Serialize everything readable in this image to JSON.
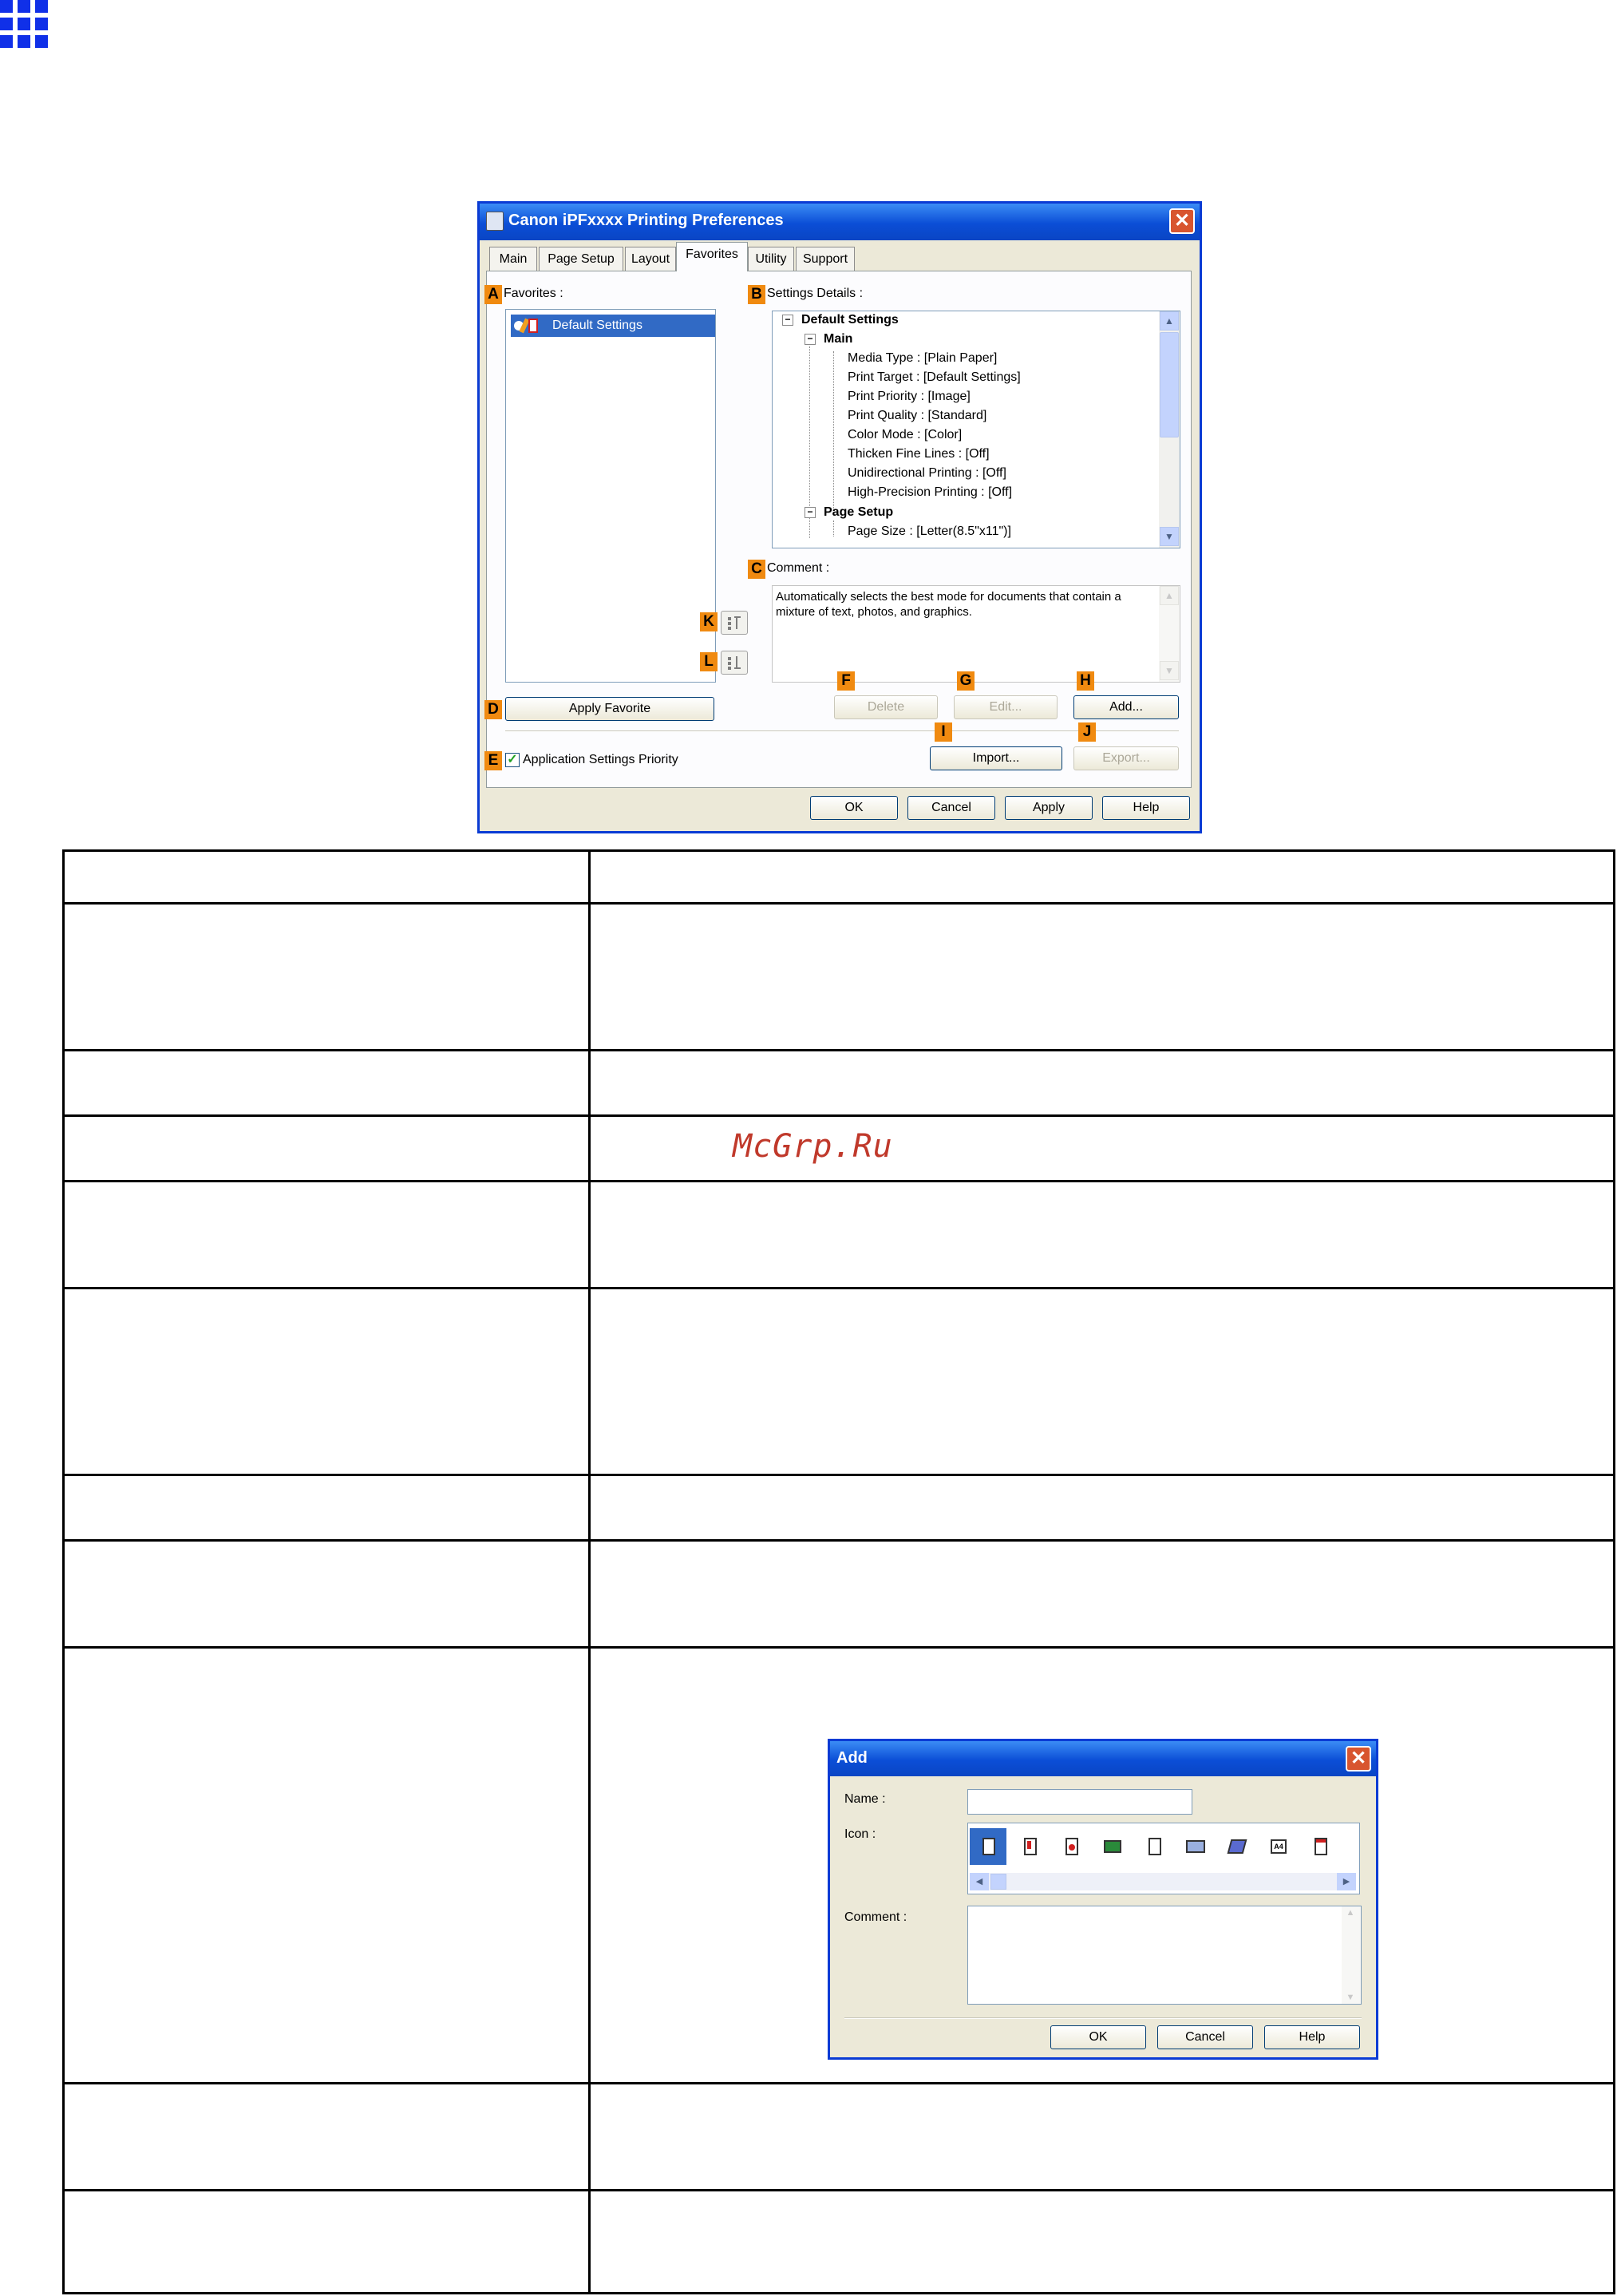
{
  "main_dialog": {
    "title": "Canon iPFxxxx Printing Preferences",
    "close_symbol": "✕",
    "tabs": [
      "Main",
      "Page Setup",
      "Layout",
      "Favorites",
      "Utility",
      "Support"
    ],
    "active_tab": "Favorites",
    "badges": [
      "A",
      "B",
      "C",
      "D",
      "E",
      "F",
      "G",
      "H",
      "I",
      "J",
      "K",
      "L"
    ],
    "favorites": {
      "label": "Favorites :",
      "items": [
        "Default Settings"
      ]
    },
    "settings_details": {
      "label": "Settings Details :",
      "root": "Default Settings",
      "main_group": "Main",
      "main_items": [
        "Media Type : [Plain Paper]",
        "Print Target : [Default Settings]",
        "Print Priority : [Image]",
        "Print Quality : [Standard]",
        "Color Mode : [Color]",
        "Thicken Fine Lines : [Off]",
        "Unidirectional Printing : [Off]",
        "High-Precision Printing : [Off]"
      ],
      "page_setup_group": "Page Setup",
      "page_setup_items": [
        "Page Size : [Letter(8.5\"x11\")]"
      ]
    },
    "comment": {
      "label": "Comment :",
      "text": "Automatically selects the best mode for documents that contain a mixture of text, photos, and graphics."
    },
    "buttons": {
      "apply_favorite": "Apply Favorite",
      "delete": "Delete",
      "edit": "Edit...",
      "add": "Add...",
      "import": "Import...",
      "export": "Export...",
      "ok": "OK",
      "cancel": "Cancel",
      "apply": "Apply",
      "help": "Help"
    },
    "application_settings_priority": {
      "label": "Application Settings Priority",
      "checked": true
    },
    "colors": {
      "title_bar": "#0b4ed6",
      "badge": "#f08a10",
      "selection": "#316ac5"
    }
  },
  "watermark": "McGrp.Ru",
  "add_dialog": {
    "title": "Add",
    "close_symbol": "✕",
    "name_label": "Name :",
    "icon_label": "Icon :",
    "comment_label": "Comment :",
    "icon_names": [
      "document-icon",
      "document-red-icon",
      "chart-doc-icon",
      "photo-icon",
      "document-icon",
      "book-icon",
      "poster-icon",
      "a4-icon",
      "calendar-icon"
    ],
    "buttons": {
      "ok": "OK",
      "cancel": "Cancel",
      "help": "Help"
    }
  }
}
